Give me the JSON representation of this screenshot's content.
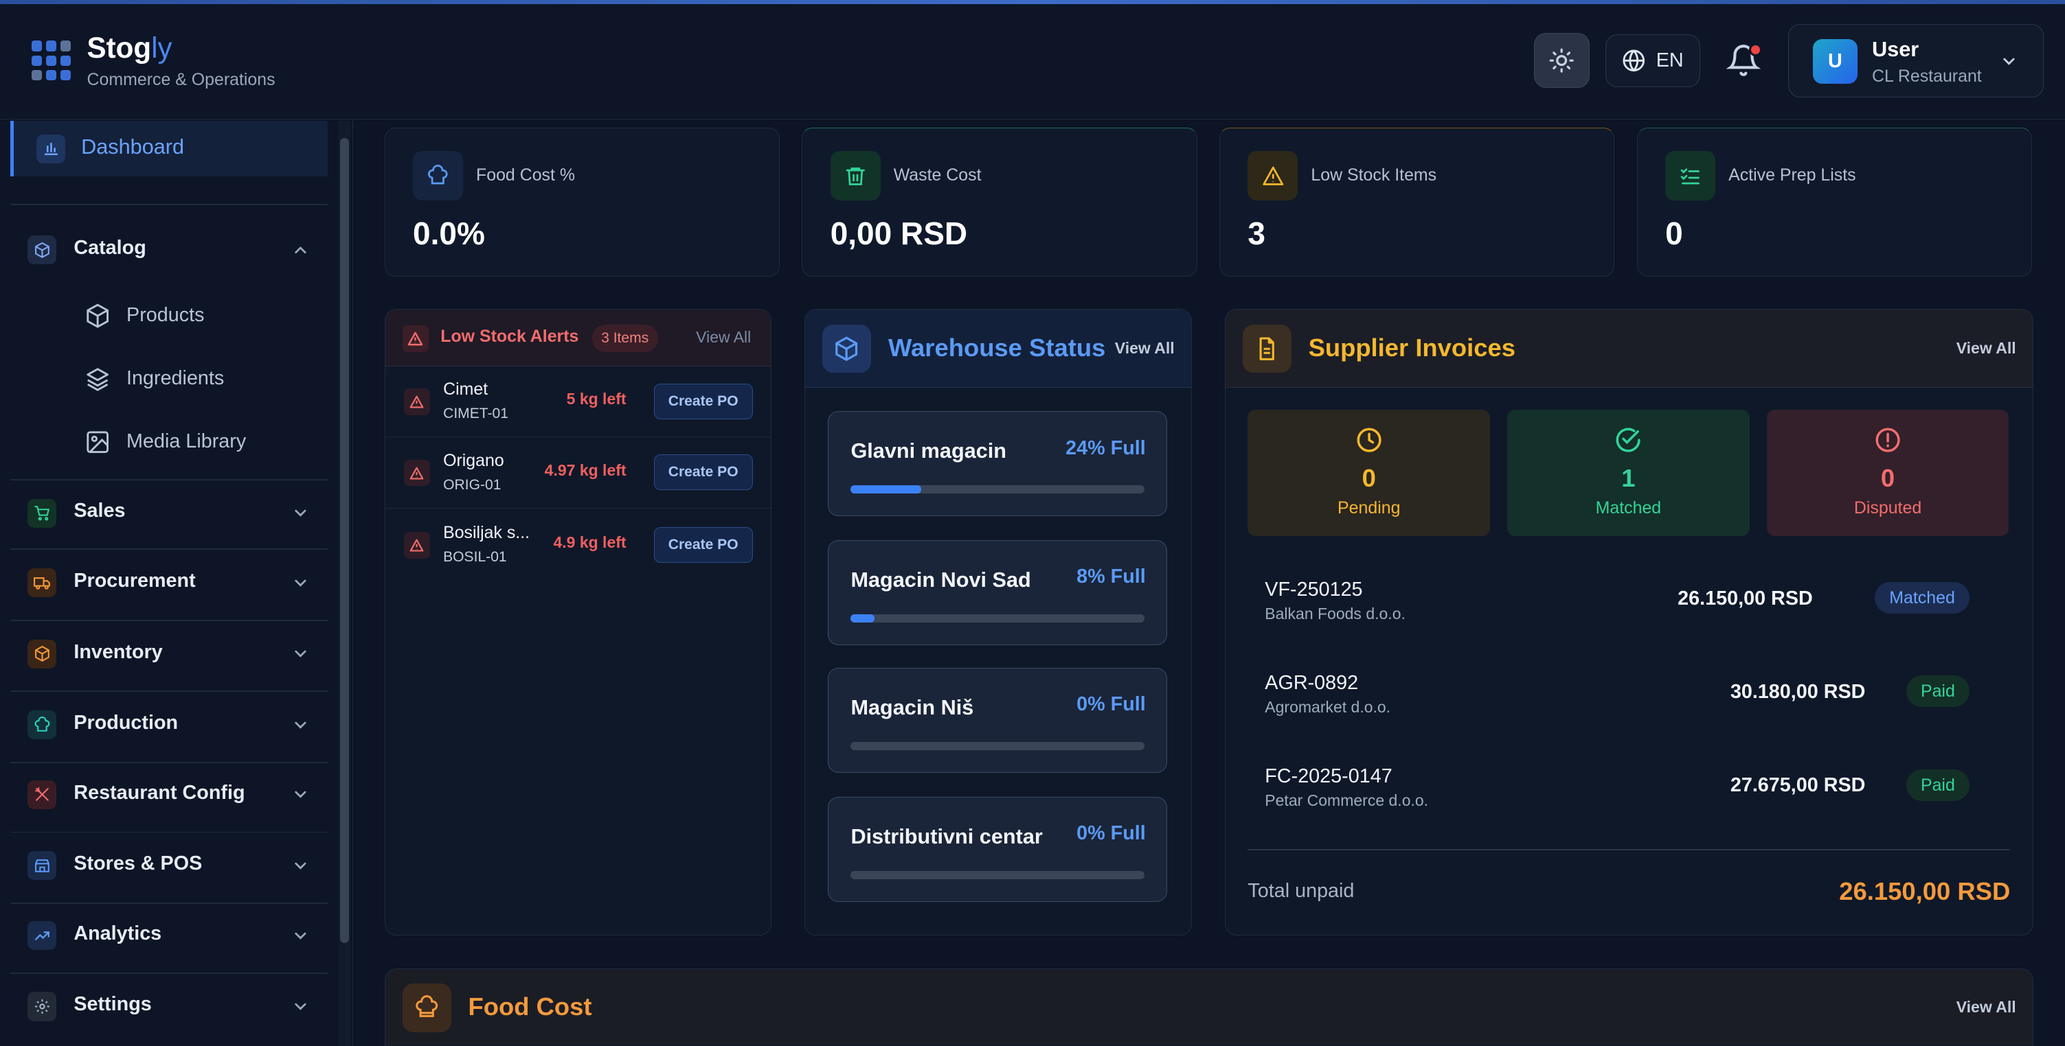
{
  "header": {
    "brand_main": "Stog",
    "brand_accent": "ly",
    "subtitle": "Commerce & Operations",
    "language": "EN",
    "user_initial": "U",
    "user_name": "User",
    "user_org": "CL Restaurant"
  },
  "sidebar": {
    "dashboard": "Dashboard",
    "catalog": "Catalog",
    "catalog_items": [
      "Products",
      "Ingredients",
      "Media Library"
    ],
    "sales": "Sales",
    "procurement": "Procurement",
    "inventory": "Inventory",
    "production": "Production",
    "restaurant_config": "Restaurant Config",
    "stores_pos": "Stores & POS",
    "analytics": "Analytics",
    "settings": "Settings"
  },
  "stats": [
    {
      "label": "Food Cost %",
      "value": "0.0%",
      "icon": "chef-hat-icon",
      "color": "#5b9af5"
    },
    {
      "label": "Waste Cost",
      "value": "0,00 RSD",
      "icon": "trash-icon",
      "color": "#34d399"
    },
    {
      "label": "Low Stock Items",
      "value": "3",
      "icon": "warning-icon",
      "color": "#f5b82e"
    },
    {
      "label": "Active Prep Lists",
      "value": "0",
      "icon": "checklist-icon",
      "color": "#34d399"
    }
  ],
  "low_stock": {
    "title": "Low Stock Alerts",
    "badge": "3 Items",
    "view_all": "View All",
    "action": "Create PO",
    "rows": [
      {
        "name": "Cimet",
        "code": "CIMET-01",
        "left": "5 kg left"
      },
      {
        "name": "Origano",
        "code": "ORIG-01",
        "left": "4.97 kg left"
      },
      {
        "name": "Bosiljak s...",
        "code": "BOSIL-01",
        "left": "4.9 kg left"
      }
    ]
  },
  "warehouse": {
    "title": "Warehouse Status",
    "view_all": "View All",
    "items": [
      {
        "name": "Glavni magacin",
        "pct_label": "24% Full",
        "fill": 0.24
      },
      {
        "name": "Magacin Novi Sad",
        "pct_label": "8% Full",
        "fill": 0.08
      },
      {
        "name": "Magacin Niš",
        "pct_label": "0% Full",
        "fill": 0
      },
      {
        "name": "Distributivni centar",
        "pct_label": "0% Full",
        "fill": 0
      }
    ]
  },
  "invoices": {
    "title": "Supplier Invoices",
    "view_all": "View All",
    "summary": [
      {
        "count": "0",
        "label": "Pending",
        "icon": "clock-icon"
      },
      {
        "count": "1",
        "label": "Matched",
        "icon": "check-circle-icon"
      },
      {
        "count": "0",
        "label": "Disputed",
        "icon": "alert-circle-icon"
      }
    ],
    "rows": [
      {
        "id": "VF-250125",
        "supplier": "Balkan Foods d.o.o.",
        "amount": "26.150,00 RSD",
        "status": "Matched"
      },
      {
        "id": "AGR-0892",
        "supplier": "Agromarket d.o.o.",
        "amount": "30.180,00 RSD",
        "status": "Paid"
      },
      {
        "id": "FC-2025-0147",
        "supplier": "Petar Commerce d.o.o.",
        "amount": "27.675,00 RSD",
        "status": "Paid"
      }
    ],
    "total_label": "Total unpaid",
    "total_value": "26.150,00 RSD"
  },
  "food_cost": {
    "title": "Food Cost",
    "view_all": "View All"
  }
}
